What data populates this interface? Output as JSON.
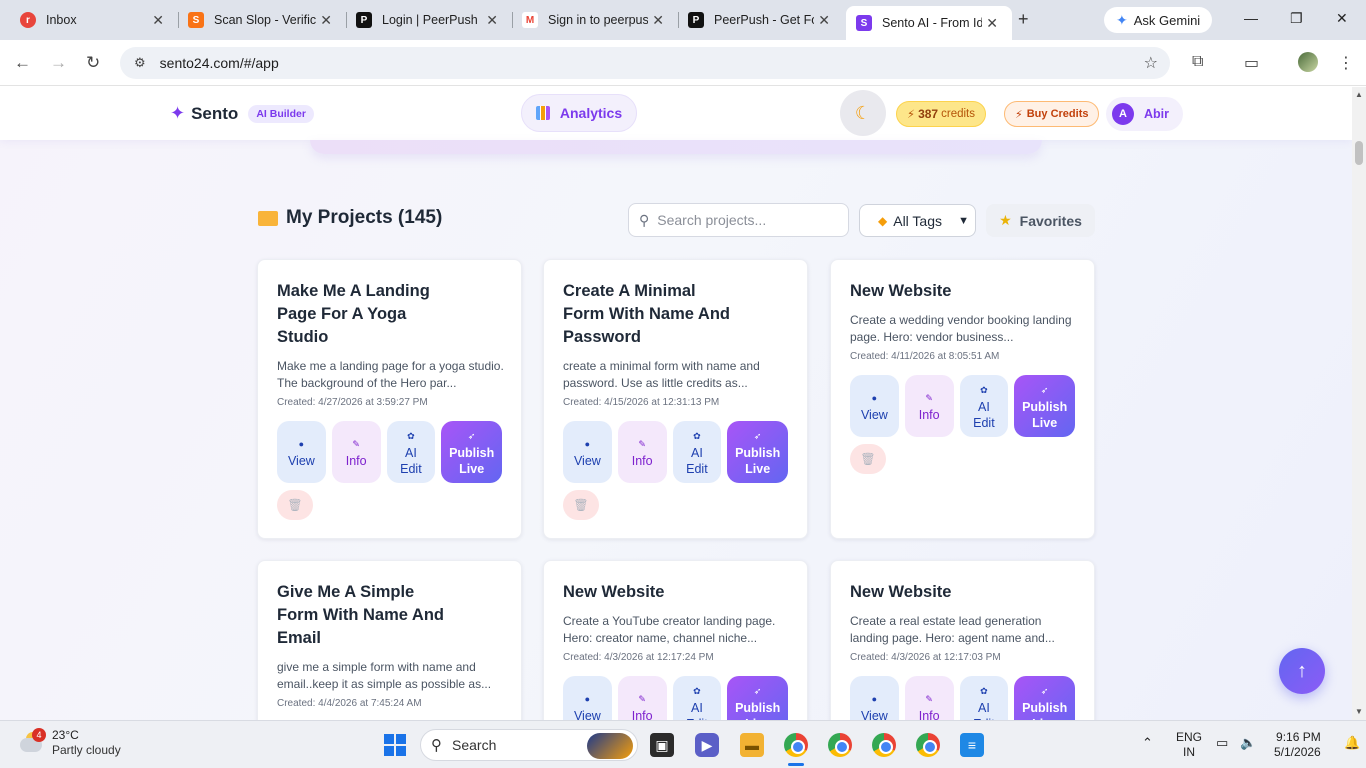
{
  "browser": {
    "tabs": [
      {
        "title": "Inbox",
        "favicon_color": "#e8453c",
        "favicon_glyph": "r"
      },
      {
        "title": "Scan Slop - Verific",
        "favicon_color": "#f97316",
        "favicon_glyph": "S"
      },
      {
        "title": "Login | PeerPush",
        "favicon_color": "#111111",
        "favicon_glyph": "P"
      },
      {
        "title": "Sign in to peerpus",
        "favicon_color": "#ea4335",
        "favicon_glyph": "M"
      },
      {
        "title": "PeerPush - Get Fo",
        "favicon_color": "#111111",
        "favicon_glyph": "P"
      },
      {
        "title": "Sento AI - From Id",
        "favicon_color": "#7c3aed",
        "favicon_glyph": "S"
      }
    ],
    "ask_gemini": "Ask Gemini",
    "url": "sento24.com/#/app"
  },
  "app": {
    "brand_name": "Sento",
    "brand_badge": "AI Builder",
    "analytics_label": "Analytics",
    "credits_value": "387",
    "credits_label": "credits",
    "buy_credits_label": "Buy Credits",
    "user_initial": "A",
    "user_name": "Abir"
  },
  "projects": {
    "title": "My Projects (145)",
    "search_placeholder": "Search projects...",
    "tags_label": "All Tags",
    "favorites_label": "Favorites",
    "actions": {
      "view": "View",
      "info": "Info",
      "ai": "AI",
      "edit": "Edit",
      "publish": "Publish",
      "live": "Live"
    },
    "cards": [
      {
        "title": "Make Me A Landing Page For A Yoga Studio",
        "desc": "Make me a landing page for a yoga studio. The background of the Hero par...",
        "created": "Created: 4/27/2026 at 3:59:27 PM"
      },
      {
        "title": "Create A Minimal Form With Name And Password",
        "desc": "create a minimal form with name and password. Use as little credits as...",
        "created": "Created: 4/15/2026 at 12:31:13 PM"
      },
      {
        "title": "New Website",
        "desc": "Create a wedding vendor booking landing page. Hero: vendor business...",
        "created": "Created: 4/11/2026 at 8:05:51 AM"
      },
      {
        "title": "Give Me A Simple Form With Name And Email",
        "desc": "give me a simple form with name and email..keep it as simple as possible as...",
        "created": "Created: 4/4/2026 at 7:45:24 AM"
      },
      {
        "title": "New Website",
        "desc": "Create a YouTube creator landing page. Hero: creator name, channel niche...",
        "created": "Created: 4/3/2026 at 12:17:24 PM"
      },
      {
        "title": "New Website",
        "desc": "Create a real estate lead generation landing page. Hero: agent name and...",
        "created": "Created: 4/3/2026 at 12:17:03 PM"
      }
    ]
  },
  "taskbar": {
    "weather_badge": "4",
    "temperature": "23°C",
    "condition": "Partly cloudy",
    "search_label": "Search",
    "lang_top": "ENG",
    "lang_bottom": "IN",
    "time": "9:16 PM",
    "date": "5/1/2026"
  }
}
